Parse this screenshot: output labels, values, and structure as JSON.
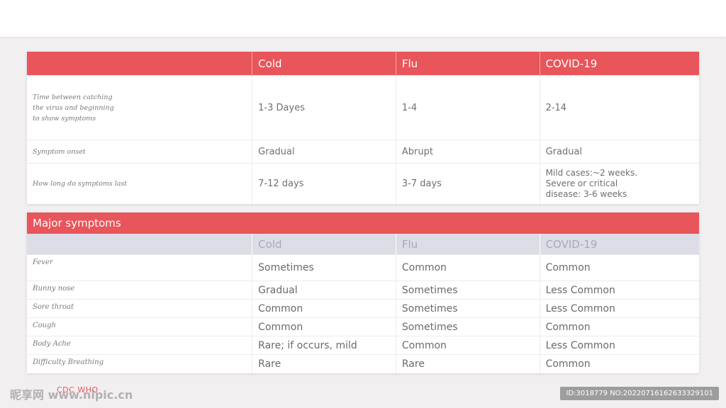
{
  "columns": [
    "Cold",
    "Flu",
    "COVID-19"
  ],
  "top_rows": [
    {
      "label": "Time between catching the virus and beginning to show symptoms",
      "cold": "1-3 Dayes",
      "flu": "1-4",
      "covid": "2-14"
    },
    {
      "label": "Symptom onset",
      "cold": "Gradual",
      "flu": "Abrupt",
      "covid": "Gradual"
    },
    {
      "label": "How long do symptoms last",
      "cold": "7-12 days",
      "flu": "3-7 days",
      "covid": "Mild cases:~2 weeks. Severe or critical disease: 3-6 weeks"
    }
  ],
  "major": {
    "title": "Major symptoms",
    "columns": [
      "Cold",
      "Flu",
      "COVID-19"
    ],
    "rows": [
      {
        "label": "Fever",
        "cold": "Sometimes",
        "flu": "Common",
        "covid": "Common"
      },
      {
        "label": "Runny nose",
        "cold": "Gradual",
        "flu": "Sometimes",
        "covid": "Less Common"
      },
      {
        "label": "Sore throat",
        "cold": "Common",
        "flu": "Sometimes",
        "covid": "Less Common"
      },
      {
        "label": "Cough",
        "cold": "Common",
        "flu": "Sometimes",
        "covid": "Common"
      },
      {
        "label": "Body Ache",
        "cold": "Rare; if occurs, mild",
        "flu": "Common",
        "covid": "Less Common"
      },
      {
        "label": "Difficulty Breathing",
        "cold": "Rare",
        "flu": "Rare",
        "covid": "Common"
      }
    ]
  },
  "source": "CDC WHO",
  "watermark_left": "昵享网 www.nipic.cn",
  "watermark_right": "ID:3018779 NO:20220716162633329101",
  "colors": {
    "accent": "#e8555a",
    "subheader": "#dcdde6",
    "background": "#f1eff0"
  }
}
